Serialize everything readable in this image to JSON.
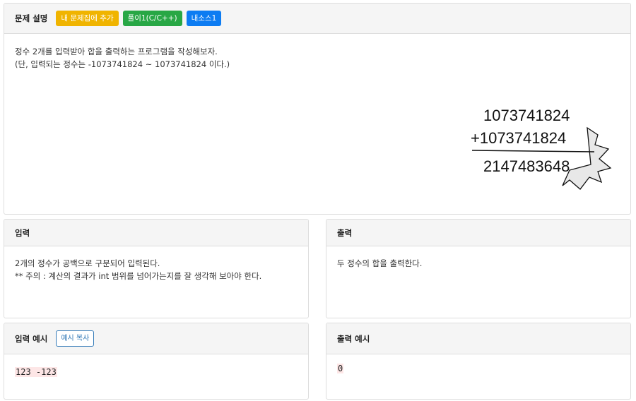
{
  "problem": {
    "title": "문제 설명",
    "buttons": [
      {
        "label": "내 문제집에 추가",
        "color": "#f0b400"
      },
      {
        "label": "풀이1(C/C++)",
        "color": "#28a745"
      },
      {
        "label": "내소스1",
        "color": "#0d7cf2"
      }
    ],
    "lines": [
      "정수 2개를 입력받아 합을 출력하는 프로그램을 작성해보자.",
      "(단, 입력되는 정수는 -1073741824 ~ 1073741824 이다.)"
    ],
    "figure": {
      "a": "1073741824",
      "b": "+1073741824",
      "sum": "2147483648"
    }
  },
  "input": {
    "title": "입력",
    "lines": [
      "2개의 정수가 공백으로 구분되어 입력된다.",
      "** 주의 : 계산의 결과가 int 범위를 넘어가는지를 잘 생각해 보아야 한다."
    ]
  },
  "output": {
    "title": "출력",
    "lines": [
      "두 정수의 합을 출력한다."
    ]
  },
  "sample_input": {
    "title": "입력 예시",
    "copy_label": "예시 복사",
    "value": "123 -123"
  },
  "sample_output": {
    "title": "출력 예시",
    "value": "0"
  }
}
